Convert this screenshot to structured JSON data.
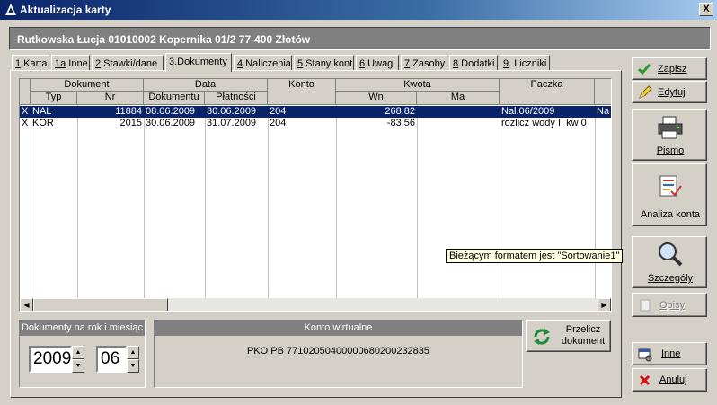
{
  "window": {
    "title": "Aktualizacja karty",
    "close_glyph": "X"
  },
  "person": {
    "header": "Rutkowska Łucja 01010002 Kopernika 01/2 77-400 Złotów"
  },
  "tabs": [
    {
      "key": "1",
      "label": ".Karta"
    },
    {
      "key": "1a",
      "label": " Inne"
    },
    {
      "key": "2",
      "label": ".Stawki/dane"
    },
    {
      "key": "3",
      "label": ".Dokumenty"
    },
    {
      "key": "4",
      "label": ".Naliczenia"
    },
    {
      "key": "5",
      "label": ".Stany kont"
    },
    {
      "key": "6",
      "label": ".Uwagi"
    },
    {
      "key": "7",
      "label": ".Zasoby"
    },
    {
      "key": "8",
      "label": ".Dodatki"
    },
    {
      "key": "9",
      "label": ". Liczniki"
    }
  ],
  "active_tab": "3.Dokumenty",
  "grid": {
    "groups": [
      "Dokument",
      "Data",
      "Konto",
      "Kwota",
      "Paczka"
    ],
    "subcols": [
      "Typ",
      "Nr",
      "Dokumentu",
      "Płatności",
      "Wn",
      "Ma"
    ],
    "rows": [
      {
        "mark": "X",
        "typ": "NAL",
        "nr": "11884",
        "data_dok": "08.06.2009",
        "data_plat": "30.06.2009",
        "konto": "204",
        "wn": "268,82",
        "ma": "",
        "paczka": "Nal.06/2009",
        "extra": "Na"
      },
      {
        "mark": "X",
        "typ": "KOR",
        "nr": "2015",
        "data_dok": "30.06.2009",
        "data_plat": "31.07.2009",
        "konto": "204",
        "wn": "-83,56",
        "ma": "",
        "paczka": "rozlicz wody II kw 0",
        "extra": ""
      }
    ]
  },
  "tooltip": "Bieżącym formatem jest \"Sortowanie1\"",
  "filter": {
    "label": "Dokumenty na rok i miesiąc",
    "year": "2009",
    "month": "06"
  },
  "virtual_account": {
    "label": "Konto wirtualne",
    "value": "PKO PB  77102050400000680200232835"
  },
  "buttons": {
    "recalc": {
      "line1": "Przelicz",
      "line2": "dokument"
    },
    "save": "Zapisz",
    "edit": "Edytuj",
    "letter": "Pismo",
    "analysis": "Analiza konta",
    "details": "Szczegóły",
    "descriptions": "Opisy",
    "other": "Inne",
    "cancel": "Anuluj"
  }
}
